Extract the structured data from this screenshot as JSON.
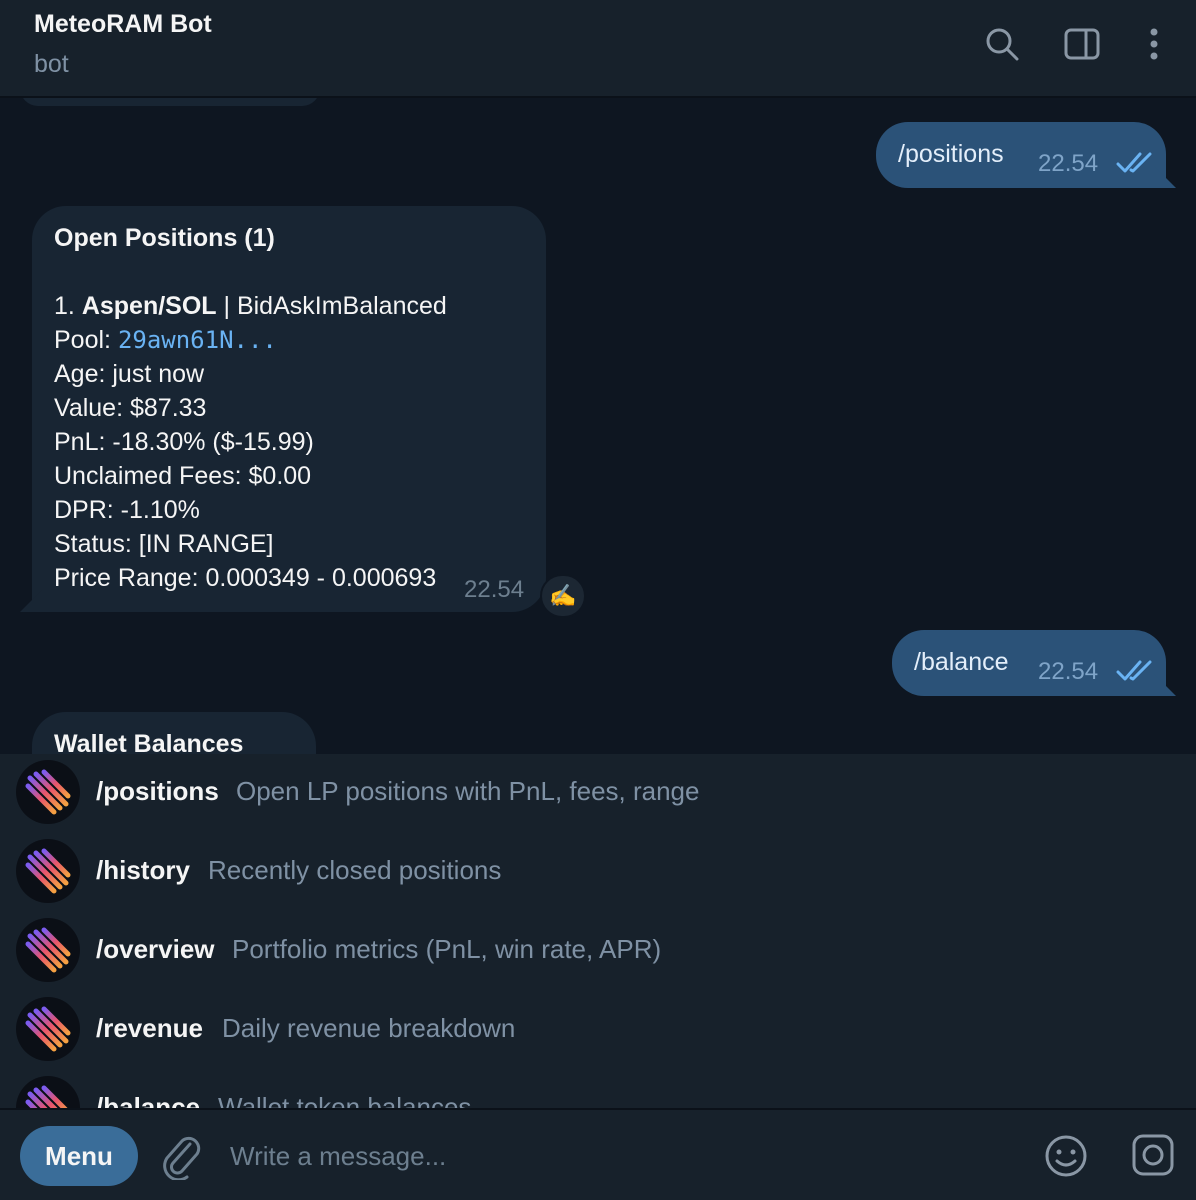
{
  "header": {
    "title": "MeteoRAM Bot",
    "subtitle": "bot"
  },
  "messages": {
    "out1": {
      "text": "/positions",
      "time": "22.54"
    },
    "positions_card": {
      "heading": "Open Positions (1)",
      "item_index": "1.",
      "pair": "Aspen/SOL",
      "strategy": " | BidAskImBalanced",
      "pool_label": "Pool: ",
      "pool_value": "29awn61N...",
      "age": "Age: just now",
      "value": "Value: $87.33",
      "pnl": "PnL: -18.30% ($-15.99)",
      "fees": "Unclaimed Fees: $0.00",
      "dpr": "DPR: -1.10%",
      "status": "Status: [IN RANGE]",
      "range": "Price Range: 0.000349 - 0.000693",
      "time": "22.54",
      "reaction": "✍️"
    },
    "out2": {
      "text": "/balance",
      "time": "22.54"
    },
    "wallet_card": {
      "heading": "Wallet Balances"
    }
  },
  "commands": [
    {
      "name": "/positions",
      "desc": "Open LP positions with PnL, fees, range"
    },
    {
      "name": "/history",
      "desc": "Recently closed positions"
    },
    {
      "name": "/overview",
      "desc": "Portfolio metrics (PnL, win rate, APR)"
    },
    {
      "name": "/revenue",
      "desc": "Daily revenue breakdown"
    },
    {
      "name": "/balance",
      "desc": "Wallet token balances"
    }
  ],
  "composer": {
    "menu_label": "Menu",
    "placeholder": "Write a message..."
  },
  "colors": {
    "background": "#0e1621",
    "panel": "#17212b",
    "outgoing_bubble": "#2b5278",
    "incoming_bubble": "#182533",
    "link": "#6ab3f3",
    "muted": "#7f91a4",
    "menu_button": "#3a6d99"
  },
  "icons": {
    "search": "search-icon",
    "side_panel": "side-panel-icon",
    "more": "more-vertical-icon",
    "attach": "paperclip-icon",
    "emoji": "emoji-icon",
    "commands": "bot-commands-icon",
    "read": "double-check-icon",
    "avatar": "meteor-logo-icon"
  }
}
